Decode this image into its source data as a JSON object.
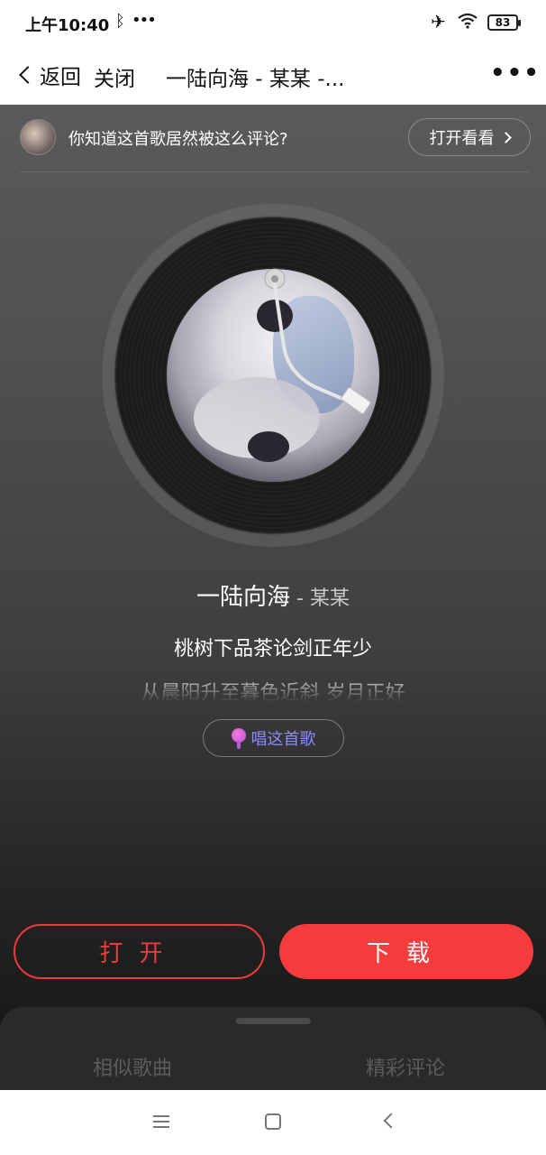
{
  "status_bar": {
    "time": "上午10:40",
    "battery": "83"
  },
  "nav": {
    "back_label": "返回",
    "close_label": "关闭",
    "title": "一陆向海 - 某某 -...",
    "more_label": "•••"
  },
  "promo": {
    "text": "你知道这首歌居然被这么评论?",
    "button_label": "打开看看"
  },
  "song": {
    "title": "一陆向海",
    "separator": " - ",
    "artist": "某某"
  },
  "lyrics": {
    "current": "桃树下品茶论剑正年少",
    "next": "从晨阳升至暮色近斜 岁月正好"
  },
  "sing_button_label": "唱这首歌",
  "actions": {
    "open_label": "打开",
    "download_label": "下载"
  },
  "sheet_tabs": {
    "similar": "相似歌曲",
    "comments": "精彩评论"
  },
  "colors": {
    "accent_red": "#f53c3c",
    "sing_purple": "#8b8cf5"
  }
}
